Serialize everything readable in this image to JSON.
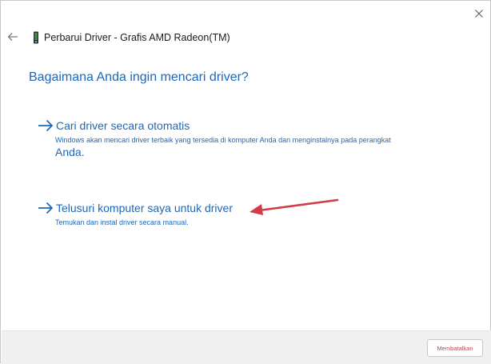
{
  "window": {
    "title": "Perbarui Driver - Grafis AMD Radeon(TM)",
    "title_icon": "device-driver-icon",
    "close_icon": "close-icon",
    "back_icon": "back-arrow-icon"
  },
  "main": {
    "heading": "Bagaimana Anda ingin mencari driver?",
    "options": [
      {
        "label": "Cari driver secara otomatis",
        "description": "Windows akan mencari driver terbaik yang tersedia di komputer Anda dan menginstalnya pada perangkat",
        "description_tail": "Anda.",
        "icon": "arrow-right-icon"
      },
      {
        "label": "Telusuri komputer saya untuk driver",
        "description": "Temukan dan instal driver secara manual.",
        "icon": "arrow-right-icon"
      }
    ],
    "annotation": {
      "icon": "red-pointer-arrow",
      "color": "#d13b4a"
    }
  },
  "footer": {
    "cancel_label": "Membatalkan"
  },
  "colors": {
    "accent": "#1d67b8",
    "footer_bg": "#f0f0f0",
    "cancel_text": "#b34a4a"
  }
}
